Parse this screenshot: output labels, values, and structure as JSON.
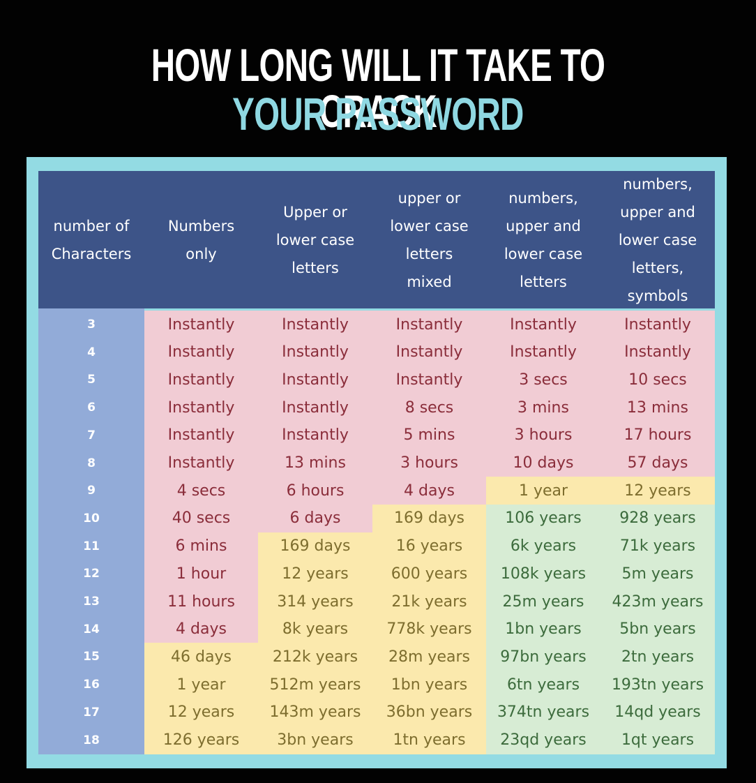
{
  "title": {
    "line1": "HOW LONG WILL IT TAKE TO CRACK",
    "line2": "YOUR PASSWORD"
  },
  "colors": {
    "header": "#3d5488",
    "number_column": "#92abd8",
    "red": "#f1ccd4",
    "yellow": "#fbe9ad",
    "green": "#d7ecd4",
    "title_accent": "#8fd8e2",
    "frame": "#93dbe3"
  },
  "chart_data": {
    "type": "table",
    "columns": [
      "number of Characters",
      "Numbers only",
      "Upper or lower case letters",
      "upper or lower case letters mixed",
      "numbers, upper and lower case letters",
      "numbers, upper and lower case letters, symbols"
    ],
    "rows": [
      {
        "chars": "3",
        "cells": [
          {
            "v": "Instantly",
            "t": "red"
          },
          {
            "v": "Instantly",
            "t": "red"
          },
          {
            "v": "Instantly",
            "t": "red"
          },
          {
            "v": "Instantly",
            "t": "red"
          },
          {
            "v": "Instantly",
            "t": "red"
          }
        ]
      },
      {
        "chars": "4",
        "cells": [
          {
            "v": "Instantly",
            "t": "red"
          },
          {
            "v": "Instantly",
            "t": "red"
          },
          {
            "v": "Instantly",
            "t": "red"
          },
          {
            "v": "Instantly",
            "t": "red"
          },
          {
            "v": "Instantly",
            "t": "red"
          }
        ]
      },
      {
        "chars": "5",
        "cells": [
          {
            "v": "Instantly",
            "t": "red"
          },
          {
            "v": "Instantly",
            "t": "red"
          },
          {
            "v": "Instantly",
            "t": "red"
          },
          {
            "v": "3 secs",
            "t": "red"
          },
          {
            "v": "10 secs",
            "t": "red"
          }
        ]
      },
      {
        "chars": "6",
        "cells": [
          {
            "v": "Instantly",
            "t": "red"
          },
          {
            "v": "Instantly",
            "t": "red"
          },
          {
            "v": "8 secs",
            "t": "red"
          },
          {
            "v": "3 mins",
            "t": "red"
          },
          {
            "v": "13 mins",
            "t": "red"
          }
        ]
      },
      {
        "chars": "7",
        "cells": [
          {
            "v": "Instantly",
            "t": "red"
          },
          {
            "v": "Instantly",
            "t": "red"
          },
          {
            "v": "5 mins",
            "t": "red"
          },
          {
            "v": "3 hours",
            "t": "red"
          },
          {
            "v": "17 hours",
            "t": "red"
          }
        ]
      },
      {
        "chars": "8",
        "cells": [
          {
            "v": "Instantly",
            "t": "red"
          },
          {
            "v": "13 mins",
            "t": "red"
          },
          {
            "v": "3 hours",
            "t": "red"
          },
          {
            "v": "10 days",
            "t": "red"
          },
          {
            "v": "57 days",
            "t": "red"
          }
        ]
      },
      {
        "chars": "9",
        "cells": [
          {
            "v": "4 secs",
            "t": "red"
          },
          {
            "v": "6 hours",
            "t": "red"
          },
          {
            "v": "4 days",
            "t": "red"
          },
          {
            "v": "1 year",
            "t": "yellow"
          },
          {
            "v": "12 years",
            "t": "yellow"
          }
        ]
      },
      {
        "chars": "10",
        "cells": [
          {
            "v": "40 secs",
            "t": "red"
          },
          {
            "v": "6 days",
            "t": "red"
          },
          {
            "v": "169 days",
            "t": "yellow"
          },
          {
            "v": "106 years",
            "t": "green"
          },
          {
            "v": "928 years",
            "t": "green"
          }
        ]
      },
      {
        "chars": "11",
        "cells": [
          {
            "v": "6 mins",
            "t": "red"
          },
          {
            "v": "169 days",
            "t": "yellow"
          },
          {
            "v": "16 years",
            "t": "yellow"
          },
          {
            "v": "6k years",
            "t": "green"
          },
          {
            "v": "71k years",
            "t": "green"
          }
        ]
      },
      {
        "chars": "12",
        "cells": [
          {
            "v": "1 hour",
            "t": "red"
          },
          {
            "v": "12 years",
            "t": "yellow"
          },
          {
            "v": "600 years",
            "t": "yellow"
          },
          {
            "v": "108k years",
            "t": "green"
          },
          {
            "v": "5m years",
            "t": "green"
          }
        ]
      },
      {
        "chars": "13",
        "cells": [
          {
            "v": "11 hours",
            "t": "red"
          },
          {
            "v": "314 years",
            "t": "yellow"
          },
          {
            "v": "21k years",
            "t": "yellow"
          },
          {
            "v": "25m years",
            "t": "green"
          },
          {
            "v": "423m years",
            "t": "green"
          }
        ]
      },
      {
        "chars": "14",
        "cells": [
          {
            "v": "4 days",
            "t": "red"
          },
          {
            "v": "8k years",
            "t": "yellow"
          },
          {
            "v": "778k years",
            "t": "yellow"
          },
          {
            "v": "1bn years",
            "t": "green"
          },
          {
            "v": "5bn years",
            "t": "green"
          }
        ]
      },
      {
        "chars": "15",
        "cells": [
          {
            "v": "46 days",
            "t": "yellow"
          },
          {
            "v": "212k years",
            "t": "yellow"
          },
          {
            "v": "28m years",
            "t": "yellow"
          },
          {
            "v": "97bn years",
            "t": "green"
          },
          {
            "v": "2tn years",
            "t": "green"
          }
        ]
      },
      {
        "chars": "16",
        "cells": [
          {
            "v": "1 year",
            "t": "yellow"
          },
          {
            "v": "512m years",
            "t": "yellow"
          },
          {
            "v": "1bn years",
            "t": "yellow"
          },
          {
            "v": "6tn years",
            "t": "green"
          },
          {
            "v": "193tn years",
            "t": "green"
          }
        ]
      },
      {
        "chars": "17",
        "cells": [
          {
            "v": "12 years",
            "t": "yellow"
          },
          {
            "v": "143m years",
            "t": "yellow"
          },
          {
            "v": "36bn years",
            "t": "yellow"
          },
          {
            "v": "374tn years",
            "t": "green"
          },
          {
            "v": "14qd years",
            "t": "green"
          }
        ]
      },
      {
        "chars": "18",
        "cells": [
          {
            "v": "126 years",
            "t": "yellow"
          },
          {
            "v": "3bn years",
            "t": "yellow"
          },
          {
            "v": "1tn years",
            "t": "yellow"
          },
          {
            "v": "23qd years",
            "t": "green"
          },
          {
            "v": "1qt years",
            "t": "green"
          }
        ]
      }
    ]
  }
}
